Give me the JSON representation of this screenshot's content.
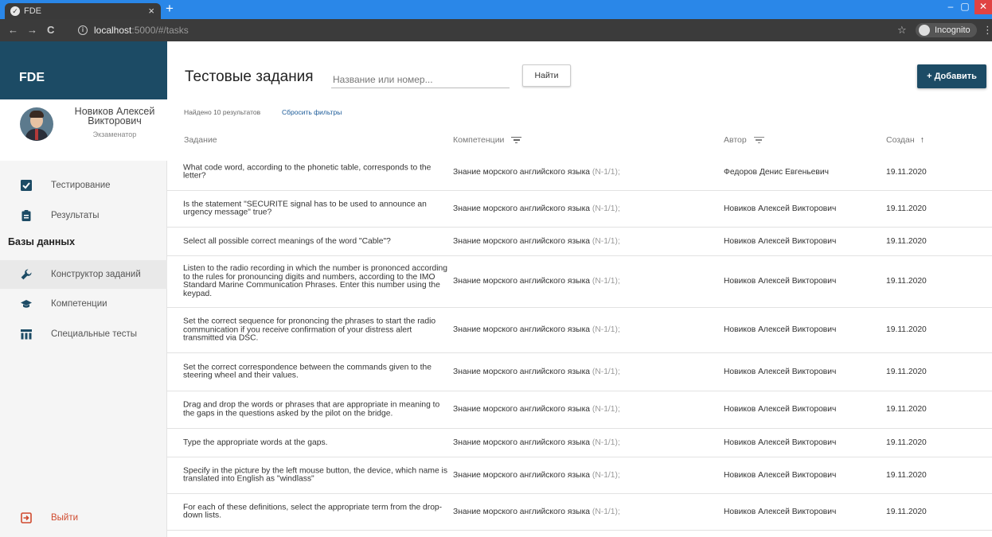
{
  "browser": {
    "tab_title": "FDE",
    "tab_close": "×",
    "new_tab": "+",
    "url_host": "localhost",
    "url_path": ":5000/#/tasks",
    "incognito_label": "Incognito"
  },
  "sidebar": {
    "brand": "FDE",
    "user": {
      "name": "Новиков Алексей Викторович",
      "role": "Экзаменатор"
    },
    "items": [
      {
        "label": "Тестирование",
        "icon": "checkbox-icon"
      },
      {
        "label": "Результаты",
        "icon": "clipboard-icon"
      }
    ],
    "section_title": "Базы данных",
    "db_items": [
      {
        "label": "Конструктор заданий",
        "icon": "wrench-icon",
        "active": true
      },
      {
        "label": "Компетенции",
        "icon": "graduation-cap-icon"
      },
      {
        "label": "Специальные тесты",
        "icon": "table-icon"
      }
    ],
    "logout": "Выйти"
  },
  "header": {
    "title": "Тестовые задания",
    "search_placeholder": "Название или номер...",
    "find_button": "Найти",
    "add_button": "+ Добавить"
  },
  "filters": {
    "found": "Найдено 10 результатов",
    "reset": "Сбросить фильтры"
  },
  "table": {
    "columns": [
      "Задание",
      "Компетенции",
      "Автор",
      "Создан"
    ],
    "sort_arrow": "↑",
    "rows": [
      {
        "task": "What code word, according to the phonetic table, corresponds to the letter?",
        "competence": "Знание морского английского языка",
        "code": "(N-1/1);",
        "author": "Федоров Денис Евгеньевич",
        "date": "19.11.2020"
      },
      {
        "task": "Is the statement \"SECURITE signal has to be used to announce an urgency message\" true?",
        "competence": "Знание морского английского языка",
        "code": "(N-1/1);",
        "author": "Новиков Алексей Викторович",
        "date": "19.11.2020"
      },
      {
        "task": "Select all possible correct meanings of the word \"Cable\"?",
        "competence": "Знание морского английского языка",
        "code": "(N-1/1);",
        "author": "Новиков Алексей Викторович",
        "date": "19.11.2020"
      },
      {
        "task": "Listen to the radio recording in which the number is prononced according to the rules for pronouncing digits and numbers, according to the IMO Standard Marine Communication Phrases. Enter this number using the keypad.",
        "competence": "Знание морского английского языка",
        "code": "(N-1/1);",
        "author": "Новиков Алексей Викторович",
        "date": "19.11.2020"
      },
      {
        "task": "Set the correct sequence for prononcing the phrases to start the radio communication if you receive confirmation of your distress alert transmitted via DSC.",
        "competence": "Знание морского английского языка",
        "code": "(N-1/1);",
        "author": "Новиков Алексей Викторович",
        "date": "19.11.2020"
      },
      {
        "task": "Set the correct correspondence between the commands given to the steering wheel and their values.",
        "competence": "Знание морского английского языка",
        "code": "(N-1/1);",
        "author": "Новиков Алексей Викторович",
        "date": "19.11.2020"
      },
      {
        "task": "Drag and drop the words or phrases that are appropriate in meaning to the gaps in the questions asked by the pilot on the bridge.",
        "competence": "Знание морского английского языка",
        "code": "(N-1/1);",
        "author": "Новиков Алексей Викторович",
        "date": "19.11.2020"
      },
      {
        "task": "Type the appropriate words at the gaps.",
        "competence": "Знание морского английского языка",
        "code": "(N-1/1);",
        "author": "Новиков Алексей Викторович",
        "date": "19.11.2020"
      },
      {
        "task": "Specify in the picture by the left mouse button, the device, which name is translated into English as \"windlass\"",
        "competence": "Знание морского английского языка",
        "code": "(N-1/1);",
        "author": "Новиков Алексей Викторович",
        "date": "19.11.2020"
      },
      {
        "task": "For each of these definitions, select the appropriate term from the drop-down lists.",
        "competence": "Знание морского английского языка",
        "code": "(N-1/1);",
        "author": "Новиков Алексей Викторович",
        "date": "19.11.2020"
      }
    ]
  },
  "colors": {
    "brand": "#1c4b65",
    "browser_tabbar": "#2a87e8",
    "link": "#1a5a98",
    "logout": "#d04a2e",
    "icon_accent": "#1c4b65"
  }
}
